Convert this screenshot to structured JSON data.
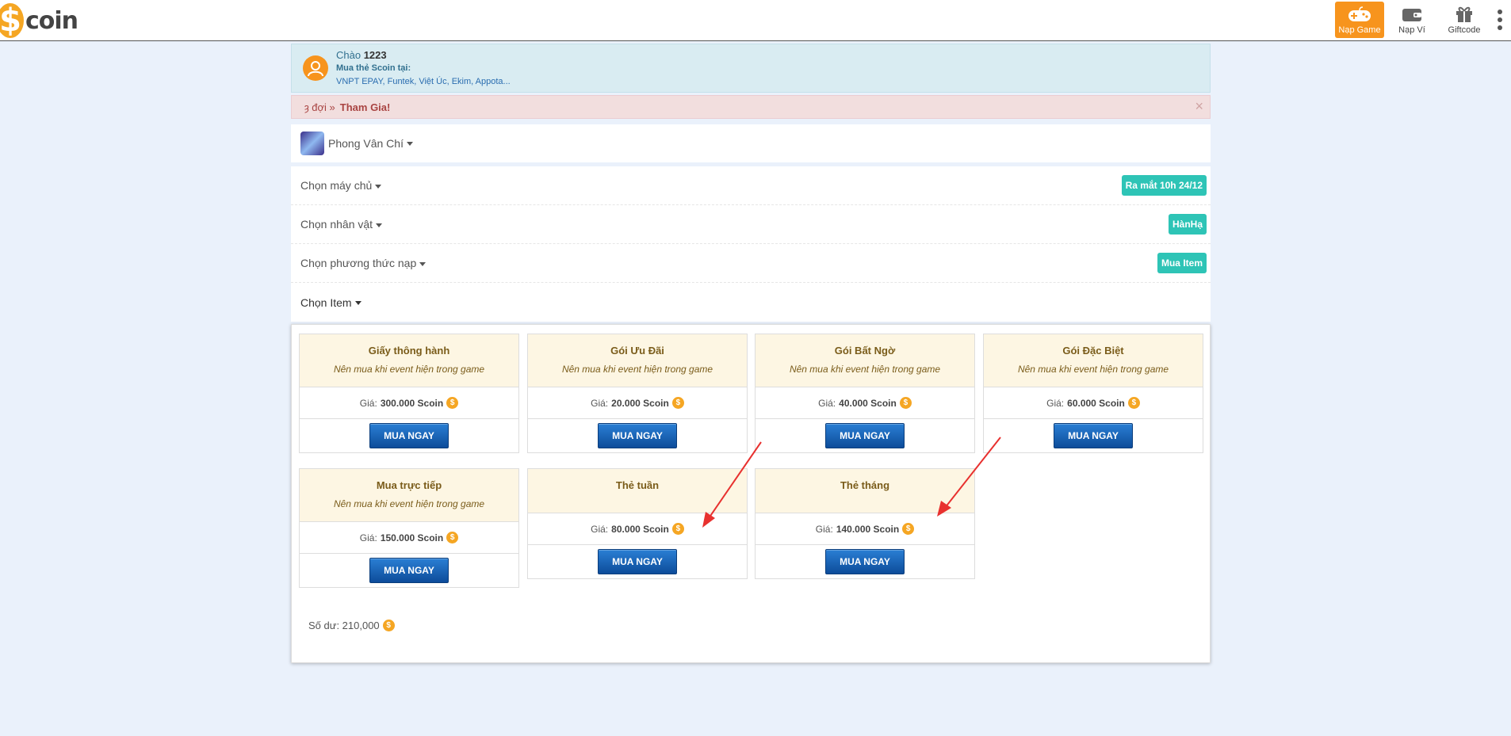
{
  "header": {
    "logo_symbol": "$",
    "logo_text": "coin",
    "nav": [
      {
        "label": "Nạp Game",
        "icon": "gamepad-icon",
        "active": true
      },
      {
        "label": "Nạp Ví",
        "icon": "wallet-icon",
        "active": false
      },
      {
        "label": "Giftcode",
        "icon": "gift-icon",
        "active": false
      }
    ]
  },
  "welcome": {
    "greeting": "Chào",
    "username": "1223",
    "buy_label": "Mua thẻ Scoin tại:",
    "vendors": "VNPT EPAY, Funtek, Việt Úc, Ekim, Appota..."
  },
  "alert": {
    "prefix": "ȝ đợi »",
    "link": "Tham Gia!",
    "close": "×"
  },
  "game": {
    "name": "Phong Vân Chí"
  },
  "selects": [
    {
      "label": "Chọn máy chủ",
      "badge": "Ra mắt 10h 24/12"
    },
    {
      "label": "Chọn nhân vật",
      "badge": "HànHạ"
    },
    {
      "label": "Chọn phương thức nạp",
      "badge": "Mua Item"
    },
    {
      "label": "Chọn Item",
      "badge": ""
    }
  ],
  "items": [
    {
      "title": "Giấy thông hành",
      "desc": "Nên mua khi event hiện trong game",
      "price_label": "Giá:",
      "price": "300.000 Scoin",
      "button": "MUA NGAY"
    },
    {
      "title": "Gói Ưu Đãi",
      "desc": "Nên mua khi event hiện trong game",
      "price_label": "Giá:",
      "price": "20.000 Scoin",
      "button": "MUA NGAY"
    },
    {
      "title": "Gói Bất Ngờ",
      "desc": "Nên mua khi event hiện trong game",
      "price_label": "Giá:",
      "price": "40.000 Scoin",
      "button": "MUA NGAY"
    },
    {
      "title": "Gói Đặc Biệt",
      "desc": "Nên mua khi event hiện trong game",
      "price_label": "Giá:",
      "price": "60.000 Scoin",
      "button": "MUA NGAY"
    },
    {
      "title": "Mua trực tiếp",
      "desc": "Nên mua khi event hiện trong game",
      "price_label": "Giá:",
      "price": "150.000 Scoin",
      "button": "MUA NGAY"
    },
    {
      "title": "Thẻ tuần",
      "desc": "",
      "price_label": "Giá:",
      "price": "80.000 Scoin",
      "button": "MUA NGAY"
    },
    {
      "title": "Thẻ tháng",
      "desc": "",
      "price_label": "Giá:",
      "price": "140.000 Scoin",
      "button": "MUA NGAY"
    }
  ],
  "coin_symbol": "$",
  "balance": {
    "label": "Số dư: 210,000"
  },
  "colors": {
    "accent": "#f7941d",
    "teal": "#2ec4b6",
    "annotation_arrow": "#e8312f"
  }
}
